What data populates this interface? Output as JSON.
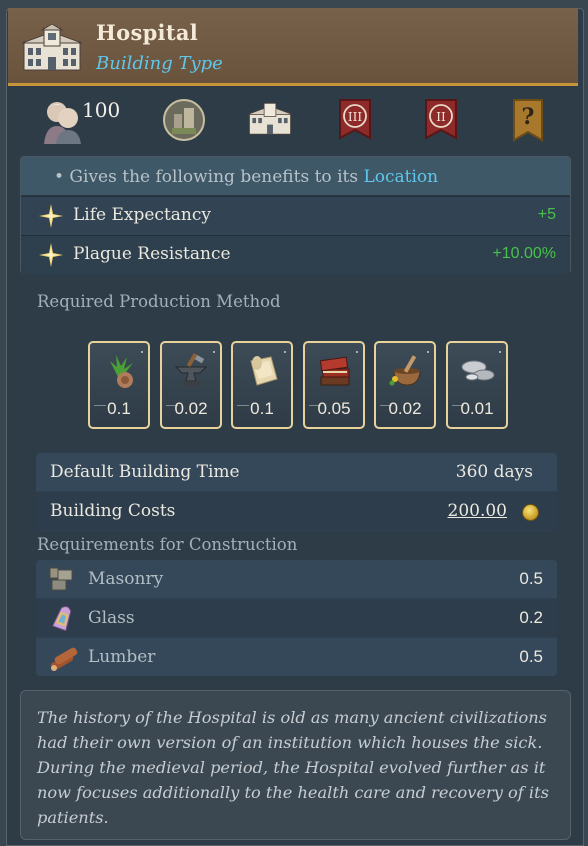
{
  "header": {
    "title": "Hospital",
    "subtitle": "Building Type",
    "icon": "hospital-building-icon"
  },
  "top_row": {
    "population_value": "100",
    "icons": [
      "population-icon",
      "castle-town-icon",
      "hospital-icon",
      "rank-III-banner-icon",
      "rank-II-banner-icon",
      "unknown-question-banner-icon"
    ],
    "banner_labels": [
      "III",
      "II",
      "?"
    ]
  },
  "benefits": {
    "intro_prefix": "• Gives the following benefits to its ",
    "intro_link": "Location",
    "rows": [
      {
        "label": "Life Expectancy",
        "value": "+5"
      },
      {
        "label": "Plague Resistance",
        "value": "+10.00%"
      }
    ]
  },
  "production": {
    "title": "Required Production Method",
    "items": [
      {
        "icon": "herbs-icon",
        "amount": "0.1"
      },
      {
        "icon": "anvil-tools-icon",
        "amount": "0.02"
      },
      {
        "icon": "paper-cloth-icon",
        "amount": "0.1"
      },
      {
        "icon": "books-icon",
        "amount": "0.05"
      },
      {
        "icon": "medicine-mortar-icon",
        "amount": "0.02"
      },
      {
        "icon": "silver-metal-icon",
        "amount": "0.01"
      }
    ]
  },
  "build": {
    "time_label": "Default Building Time",
    "time_value": "360 days",
    "cost_label": "Building Costs",
    "cost_value": "200.00"
  },
  "requirements": {
    "title": "Requirements for Construction",
    "rows": [
      {
        "icon": "masonry-icon",
        "label": "Masonry",
        "value": "0.5"
      },
      {
        "icon": "glass-icon",
        "label": "Glass",
        "value": "0.2"
      },
      {
        "icon": "lumber-icon",
        "label": "Lumber",
        "value": "0.5"
      }
    ]
  },
  "description": "The history of the Hospital is old as many ancient civilizations had their own version of an institution which houses the sick. During the medieval period, the Hospital evolved further as it now focuses additionally to the health care and recovery of its patients.",
  "colors": {
    "accent_blue": "#5fc7ec",
    "positive_green": "#47c24a",
    "header_brown": "#78614a",
    "gold_border": "#c4953b"
  }
}
